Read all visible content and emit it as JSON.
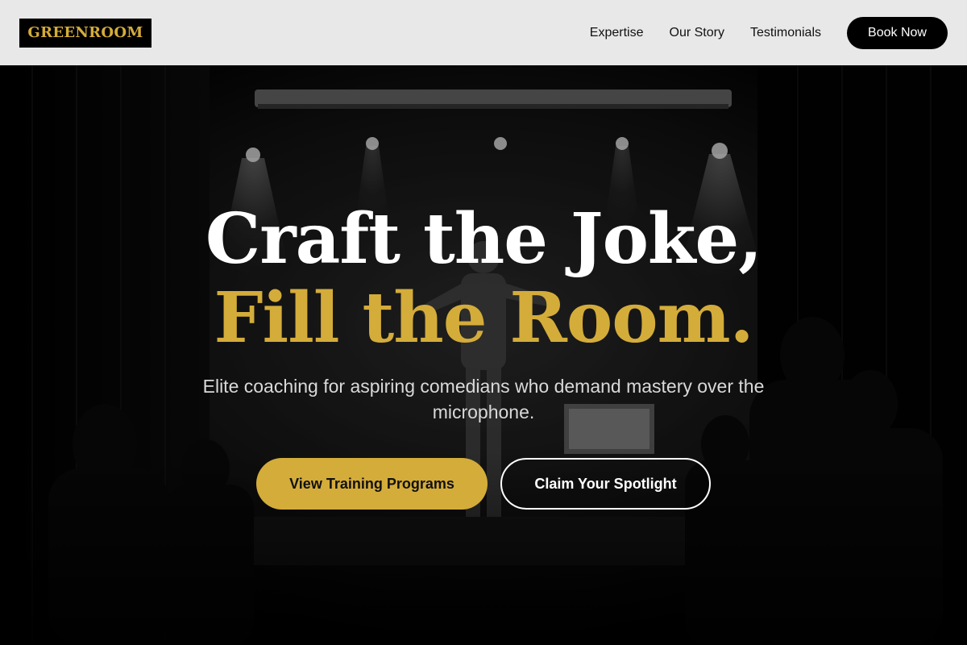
{
  "header": {
    "logo_text": "GREENROOM",
    "nav": [
      {
        "label": "Expertise"
      },
      {
        "label": "Our Story"
      },
      {
        "label": "Testimonials"
      }
    ],
    "book_label": "Book Now"
  },
  "hero": {
    "headline_line1": "Craft the Joke,",
    "headline_line2": "Fill the Room.",
    "subtitle": "Elite coaching for aspiring comedians who demand mastery over the microphone.",
    "primary_cta": "View Training Programs",
    "secondary_cta": "Claim Your Spotlight",
    "background_image_icon": "stage-performer-photo"
  },
  "colors": {
    "accent": "#d4ac3a",
    "header_bg": "#e8e8e8",
    "hero_bg": "#000000",
    "text_light": "#ffffff"
  }
}
